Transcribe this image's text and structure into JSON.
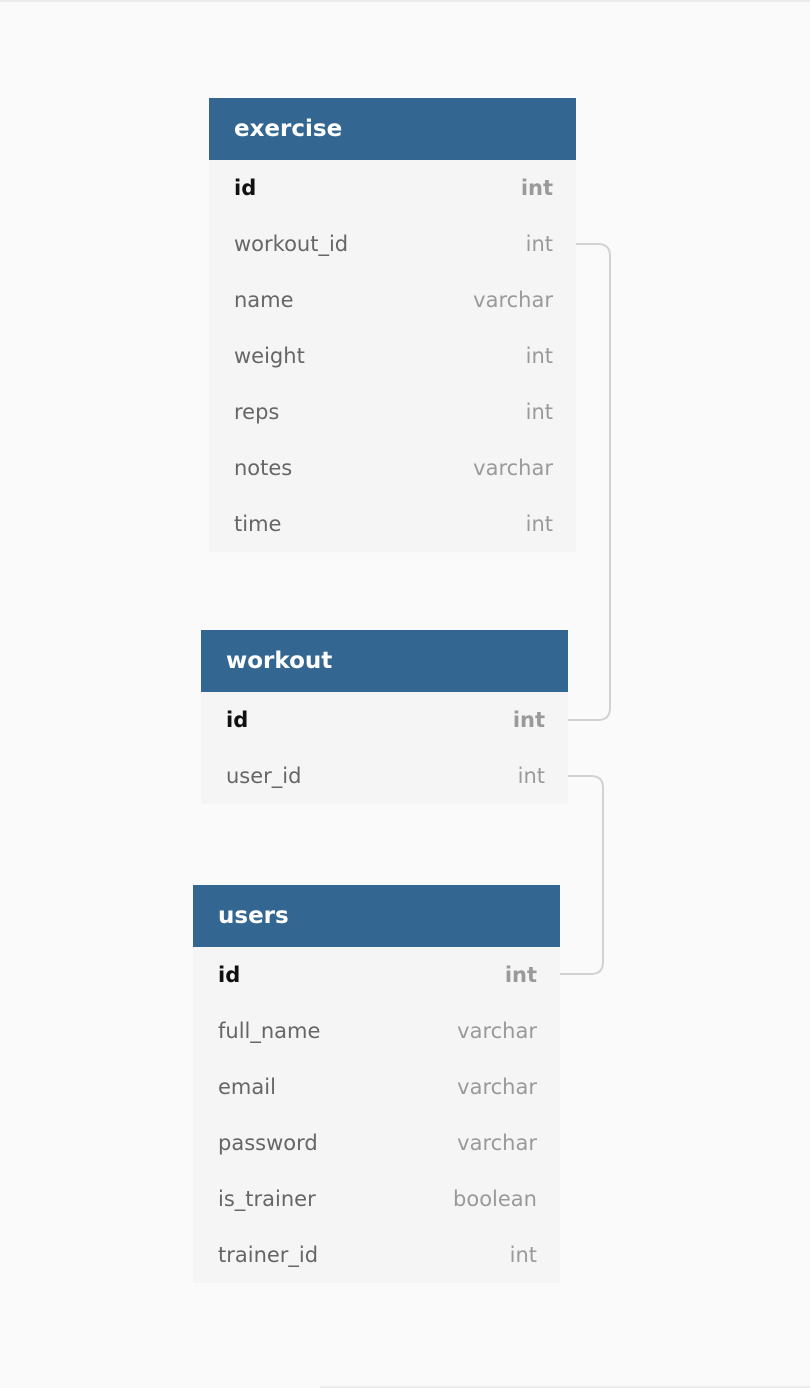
{
  "tables": [
    {
      "name": "exercise",
      "columns": [
        {
          "name": "id",
          "type": "int",
          "primary_key": true
        },
        {
          "name": "workout_id",
          "type": "int",
          "primary_key": false
        },
        {
          "name": "name",
          "type": "varchar",
          "primary_key": false
        },
        {
          "name": "weight",
          "type": "int",
          "primary_key": false
        },
        {
          "name": "reps",
          "type": "int",
          "primary_key": false
        },
        {
          "name": "notes",
          "type": "varchar",
          "primary_key": false
        },
        {
          "name": "time",
          "type": "int",
          "primary_key": false
        }
      ]
    },
    {
      "name": "workout",
      "columns": [
        {
          "name": "id",
          "type": "int",
          "primary_key": true
        },
        {
          "name": "user_id",
          "type": "int",
          "primary_key": false
        }
      ]
    },
    {
      "name": "users",
      "columns": [
        {
          "name": "id",
          "type": "int",
          "primary_key": true
        },
        {
          "name": "full_name",
          "type": "varchar",
          "primary_key": false
        },
        {
          "name": "email",
          "type": "varchar",
          "primary_key": false
        },
        {
          "name": "password",
          "type": "varchar",
          "primary_key": false
        },
        {
          "name": "is_trainer",
          "type": "boolean",
          "primary_key": false
        },
        {
          "name": "trainer_id",
          "type": "int",
          "primary_key": false
        }
      ]
    }
  ],
  "relationships": [
    {
      "from": "exercise.workout_id",
      "to": "workout.id"
    },
    {
      "from": "workout.user_id",
      "to": "users.id"
    }
  ],
  "colors": {
    "header": "#336791",
    "body": "#f5f5f5",
    "connector": "#d2d2d2"
  }
}
